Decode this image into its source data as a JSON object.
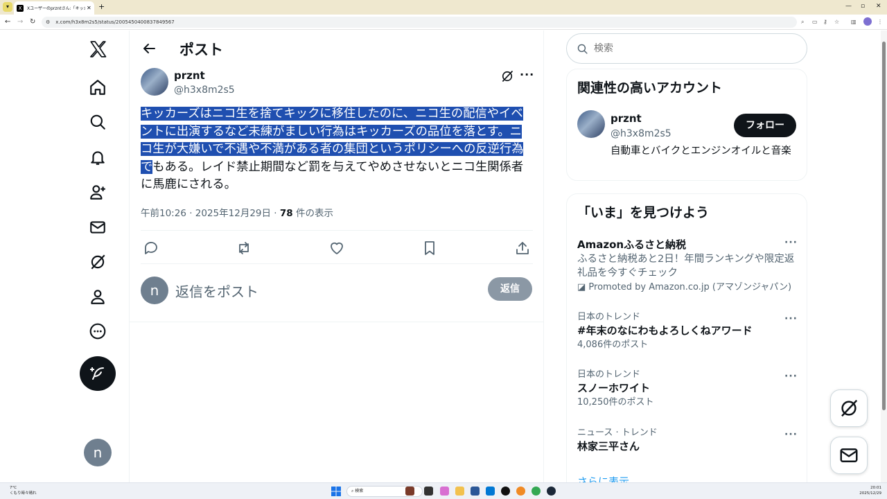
{
  "browser": {
    "tab_title": "Xユーザーのprzntさん:「キッカーズは",
    "url": "x.com/h3x8m2s5/status/2005450400837849567"
  },
  "main": {
    "title": "ポスト",
    "post": {
      "display_name": "prznt",
      "handle": "@h3x8m2s5",
      "text_selected": "キッカーズはニコ生を捨てキックに移住したのに、ニコ生の配信やイベントに出演するなど未練がましい行為はキッカーズの品位を落とす。ニコ生が大嫌いで不遇や不満がある者の集団というポリシーへの反逆行為で",
      "text_rest": "もある。レイド禁止期間など罰を与えてやめさせないとニコ生関係者に馬鹿にされる。",
      "timestamp": "午前10:26 · 2025年12月29日 · ",
      "view_count": "78",
      "views_label": " 件の表示"
    },
    "reply": {
      "avatar_letter": "n",
      "placeholder": "返信をポスト",
      "button": "返信"
    }
  },
  "nav": {
    "avatar_letter": "n"
  },
  "sidebar": {
    "search_placeholder": "検索",
    "relevant": {
      "title": "関連性の高いアカウント",
      "name": "prznt",
      "handle": "@h3x8m2s5",
      "bio": "自動車とバイクとエンジンオイルと音楽",
      "follow": "フォロー"
    },
    "trends": {
      "title": "「いま」を見つけよう",
      "items": [
        {
          "name": "Amazonふるさと納税",
          "desc": "ふるさと納税あと2日！年間ランキングや限定返礼品を今すぐチェック",
          "promo": "Promoted by Amazon.co.jp (アマゾンジャパン)"
        },
        {
          "category": "日本のトレンド",
          "name": "#年末のなにわもよろしくねアワード",
          "count": "4,086件のポスト"
        },
        {
          "category": "日本のトレンド",
          "name": "スノーホワイト",
          "count": "10,250件のポスト"
        },
        {
          "category": "ニュース · トレンド",
          "name": "林家三平さん"
        }
      ],
      "show_more": "さらに表示"
    }
  },
  "taskbar": {
    "weather_temp": "7°C",
    "weather_desc": "くもり時々晴れ",
    "search": "検索",
    "time": "20:01",
    "date": "2025/12/29"
  },
  "colors": {
    "selection": "#1f4fb0",
    "accent": "#1d9bf0",
    "text": "#0f1419",
    "muted": "#536471"
  }
}
